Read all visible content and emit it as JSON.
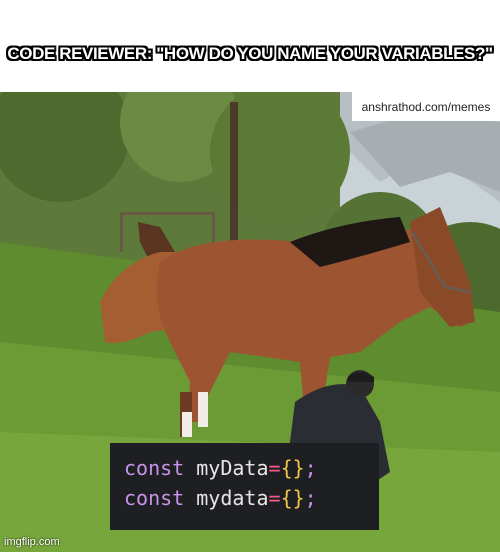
{
  "caption": "CODE REVIEWER:  \"HOW DO YOU NAME YOUR VARIABLES?\"",
  "watermark": "anshrathod.com/memes",
  "code": {
    "line1": {
      "keyword": "const",
      "name": "myData",
      "op": "=",
      "value": "{}",
      "semi": ";"
    },
    "line2": {
      "keyword": "const",
      "name": "mydata",
      "op": "=",
      "value": "{}",
      "semi": ";"
    }
  },
  "imgflip": "imgflip.com"
}
